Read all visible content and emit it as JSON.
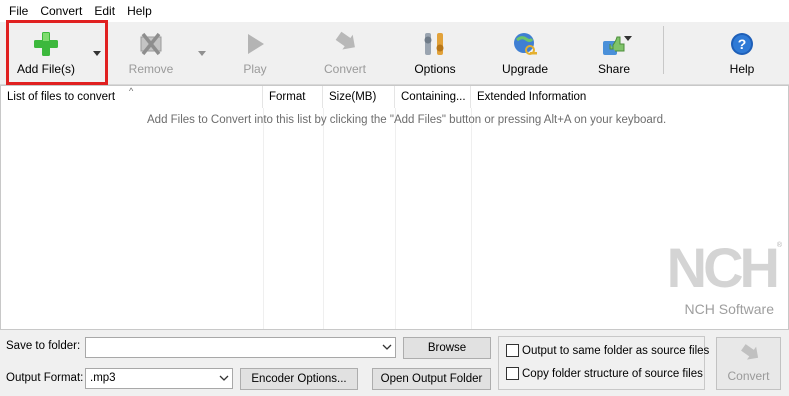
{
  "menu": {
    "file": "File",
    "convert": "Convert",
    "edit": "Edit",
    "help": "Help"
  },
  "toolbar": {
    "add_files": "Add File(s)",
    "remove": "Remove",
    "play": "Play",
    "convert": "Convert",
    "options": "Options",
    "upgrade": "Upgrade",
    "share": "Share",
    "help": "Help"
  },
  "file_list": {
    "columns": [
      "List of files to convert",
      "Format",
      "Size(MB)",
      "Containing...",
      "Extended Information"
    ],
    "empty_message": "Add Files to Convert into this list by clicking the \"Add Files\" button or pressing Alt+A on your keyboard."
  },
  "branding": {
    "logo_letters": "NCH",
    "company": "NCH Software"
  },
  "bottom": {
    "save_to_folder_label": "Save to folder:",
    "save_to_folder_value": "",
    "browse_button": "Browse",
    "output_format_label": "Output Format:",
    "output_format_value": ".mp3",
    "encoder_options_button": "Encoder Options...",
    "open_output_folder_button": "Open Output Folder",
    "output_same_folder": "Output to same folder as source files",
    "copy_folder_structure": "Copy folder structure of source files",
    "convert_button": "Convert"
  },
  "colors": {
    "highlight": "#e02020",
    "add_icon": "#3cb83c",
    "disabled_text": "#9a9a9a"
  }
}
